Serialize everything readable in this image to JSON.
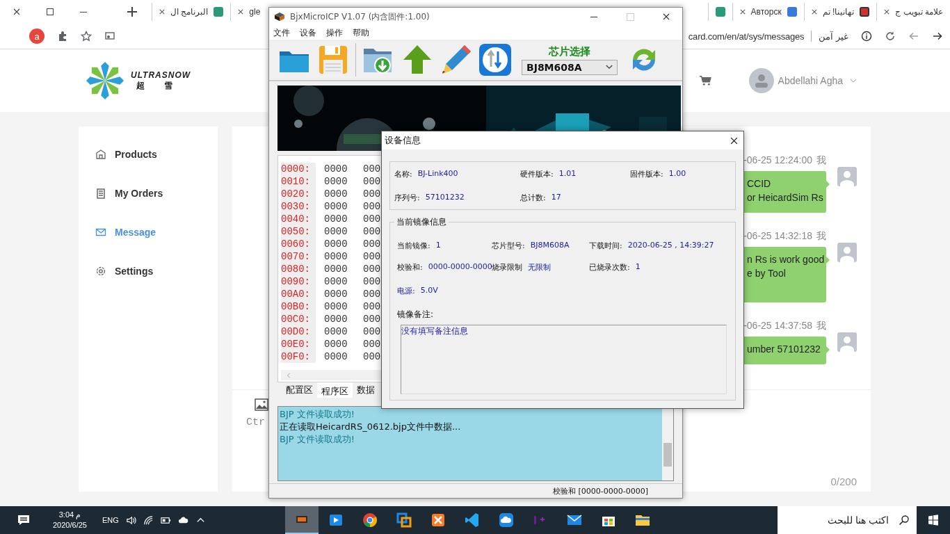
{
  "browser": {
    "tabs_left": [
      {
        "title": "البرنامج ال",
        "favicon": true
      },
      {
        "title": "gle",
        "favicon": false
      }
    ],
    "tabs_right": [
      {
        "title": "علامة تبويب ج",
        "favicon": false
      },
      {
        "title": "تهانينا! تم",
        "favicon": true
      },
      {
        "title": "Авторск",
        "favicon": true
      },
      {
        "favicon": true
      }
    ],
    "profile": "a",
    "url": "card.com/en/at/sys/messages",
    "security": "غير آمن"
  },
  "site": {
    "logo": "ULTRASNOW",
    "logo_cn": [
      "超",
      "雪"
    ],
    "user": "Abdellahi Agha",
    "sidebar": [
      {
        "label": "Products",
        "selected": false,
        "kind": "box"
      },
      {
        "label": "My Orders",
        "selected": false,
        "kind": "list"
      },
      {
        "label": "Message",
        "selected": true,
        "kind": "mail"
      },
      {
        "label": "Settings",
        "selected": false,
        "kind": "gear"
      }
    ],
    "messages": [
      {
        "time": "-06-25 12:24:00",
        "sender": "我",
        "lines": [
          "CCID",
          "or HeicardSim Rs"
        ]
      },
      {
        "time": "-06-25 14:32:18",
        "sender": "我",
        "lines": [
          "n Rs is work good",
          "e by Tool"
        ]
      },
      {
        "time": "-06-25 14:37:58",
        "sender": "我",
        "lines": [
          "umber 57101232"
        ]
      }
    ],
    "composer_hint": "Ctr",
    "counter": "0/200"
  },
  "icp": {
    "title": "BjxMicroICP V1.07 (内含固件:1.00)",
    "menu": [
      "文件",
      "设备",
      "操作",
      "帮助"
    ],
    "chip_label": "芯片选择",
    "chip": "BJ8M608A",
    "hex": [
      {
        "address": "0000:",
        "cells": [
          "0000",
          "000"
        ]
      },
      {
        "address": "0010:",
        "cells": [
          "0000",
          "000"
        ]
      },
      {
        "address": "0020:",
        "cells": [
          "0000",
          "000"
        ]
      },
      {
        "address": "0030:",
        "cells": [
          "0000",
          "000"
        ]
      },
      {
        "address": "0040:",
        "cells": [
          "0000",
          "000"
        ]
      },
      {
        "address": "0050:",
        "cells": [
          "0000",
          "000"
        ]
      },
      {
        "address": "0060:",
        "cells": [
          "0000",
          "000"
        ]
      },
      {
        "address": "0070:",
        "cells": [
          "0000",
          "000"
        ]
      },
      {
        "address": "0080:",
        "cells": [
          "0000",
          "000"
        ]
      },
      {
        "address": "0090:",
        "cells": [
          "0000",
          "000"
        ]
      },
      {
        "address": "00A0:",
        "cells": [
          "0000",
          "000"
        ]
      },
      {
        "address": "00B0:",
        "cells": [
          "0000",
          "000"
        ]
      },
      {
        "address": "00C0:",
        "cells": [
          "0000",
          "000"
        ]
      },
      {
        "address": "00D0:",
        "cells": [
          "0000",
          "000"
        ]
      },
      {
        "address": "00E0:",
        "cells": [
          "0000",
          "000"
        ]
      },
      {
        "address": "00F0:",
        "cells": [
          "0000",
          "000"
        ]
      }
    ],
    "region_tabs": [
      {
        "label": "配置区",
        "selected": false
      },
      {
        "label": "程序区",
        "selected": true
      },
      {
        "label": "数据",
        "selected": false
      }
    ],
    "log": [
      {
        "text": "BJP 文件读取成功!",
        "kind": "success"
      },
      {
        "text": "正在读取HeicardRS_0612.bjp文件中数据...",
        "kind": "info"
      },
      {
        "text": "BJP 文件读取成功!",
        "kind": "success"
      }
    ],
    "status": "校验和 [0000-0000-0000]"
  },
  "dialog": {
    "title": "设备信息",
    "device_rows": [
      [
        {
          "label": "名称:",
          "value": "BJ-Link400"
        },
        {
          "label": "硬件版本:",
          "value": "1.01"
        },
        {
          "label": "固件版本:",
          "value": "1.00"
        }
      ],
      [
        {
          "label": "序列号:",
          "value": "57101232"
        },
        {
          "label": "总计数:",
          "value": "17"
        }
      ]
    ],
    "image_group": "当前镜像信息",
    "image_rows": [
      [
        {
          "label": "当前镜像:",
          "value": "1"
        },
        {
          "label": "芯片型号:",
          "value": "BJ8M608A"
        },
        {
          "label": "下载时间:",
          "value": "2020-06-25 , 14:39:27"
        }
      ],
      [
        {
          "label": "校验和:",
          "value": "0000-0000-0000"
        },
        {
          "label": "烧录限制",
          "value": "无限制"
        },
        {
          "label": "已烧录次数:",
          "value": "1"
        }
      ]
    ],
    "power": {
      "label": "电源:",
      "value": "5.0V"
    },
    "note_label": "镜像备注:",
    "note": "没有填写备注信息"
  },
  "taskbar": {
    "time": "3:04 م",
    "date": "2020/6/25",
    "lang": "ENG",
    "search_placeholder": "اكتب هنا للبحث",
    "apps": [
      {
        "kind": "chip",
        "selected": true
      },
      {
        "kind": "media",
        "selected": false
      },
      {
        "kind": "chrome",
        "selected": false
      },
      {
        "kind": "remote",
        "selected": false
      },
      {
        "kind": "xampp",
        "selected": false
      },
      {
        "kind": "code",
        "selected": false
      },
      {
        "kind": "cloud",
        "selected": false
      },
      {
        "kind": "cpp",
        "selected": false
      },
      {
        "kind": "mail",
        "selected": false
      },
      {
        "kind": "store",
        "selected": false
      },
      {
        "kind": "folder",
        "selected": false
      }
    ]
  }
}
